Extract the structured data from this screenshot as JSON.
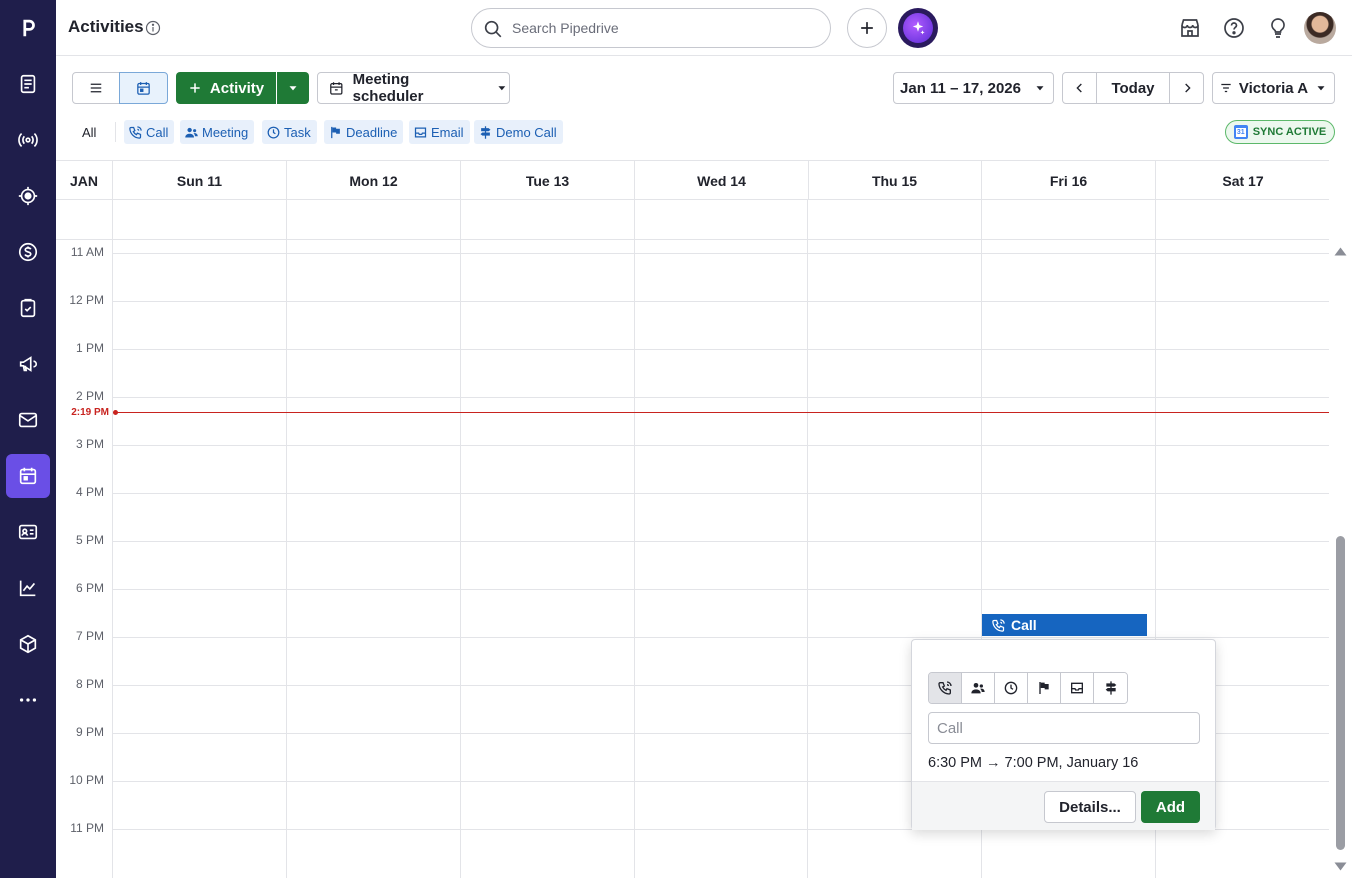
{
  "app": {
    "page_title": "Activities",
    "search_placeholder": "Search Pipedrive"
  },
  "colors": {
    "rail_bg": "#1f1e4b",
    "rail_active": "#6a4fe6",
    "primary_green": "#1f7a36",
    "event_blue": "#1665c0",
    "now_red": "#c8231f"
  },
  "sidebar": {
    "items": [
      {
        "name": "leads-inbox-icon"
      },
      {
        "name": "campaigns-radio-icon"
      },
      {
        "name": "target-icon"
      },
      {
        "name": "deals-dollar-icon"
      },
      {
        "name": "projects-clipboard-icon"
      },
      {
        "name": "megaphone-icon"
      },
      {
        "name": "mail-icon"
      },
      {
        "name": "calendar-icon",
        "active": true
      },
      {
        "name": "contacts-card-icon"
      },
      {
        "name": "insights-chart-icon"
      },
      {
        "name": "products-box-icon"
      },
      {
        "name": "more-dots-icon"
      }
    ]
  },
  "toolbar": {
    "add_activity_label": "Activity",
    "meeting_scheduler_label": "Meeting scheduler",
    "date_range": "Jan 11 – 17, 2026",
    "today_label": "Today",
    "user_filter": "Victoria A"
  },
  "filters": {
    "all_label": "All",
    "chips": [
      {
        "label": "Call",
        "icon": "phone-icon"
      },
      {
        "label": "Meeting",
        "icon": "people-icon"
      },
      {
        "label": "Task",
        "icon": "clock-icon"
      },
      {
        "label": "Deadline",
        "icon": "flag-icon"
      },
      {
        "label": "Email",
        "icon": "inbox-icon"
      },
      {
        "label": "Demo Call",
        "icon": "signpost-icon"
      }
    ],
    "sync_label": "SYNC ACTIVE"
  },
  "calendar": {
    "month": "JAN",
    "days": [
      "Sun 11",
      "Mon 12",
      "Tue 13",
      "Wed 14",
      "Thu 15",
      "Fri 16",
      "Sat 17"
    ],
    "hours": [
      "11 AM",
      "12 PM",
      "1 PM",
      "2 PM",
      "3 PM",
      "4 PM",
      "5 PM",
      "6 PM",
      "7 PM",
      "8 PM",
      "9 PM",
      "10 PM",
      "11 PM"
    ],
    "now_label": "2:19 PM",
    "event": {
      "title": "Call",
      "day": "Fri 16"
    }
  },
  "popover": {
    "subject_placeholder": "Call",
    "when": "6:30 PM → 7:00 PM, January 16",
    "details_label": "Details...",
    "add_label": "Add"
  }
}
